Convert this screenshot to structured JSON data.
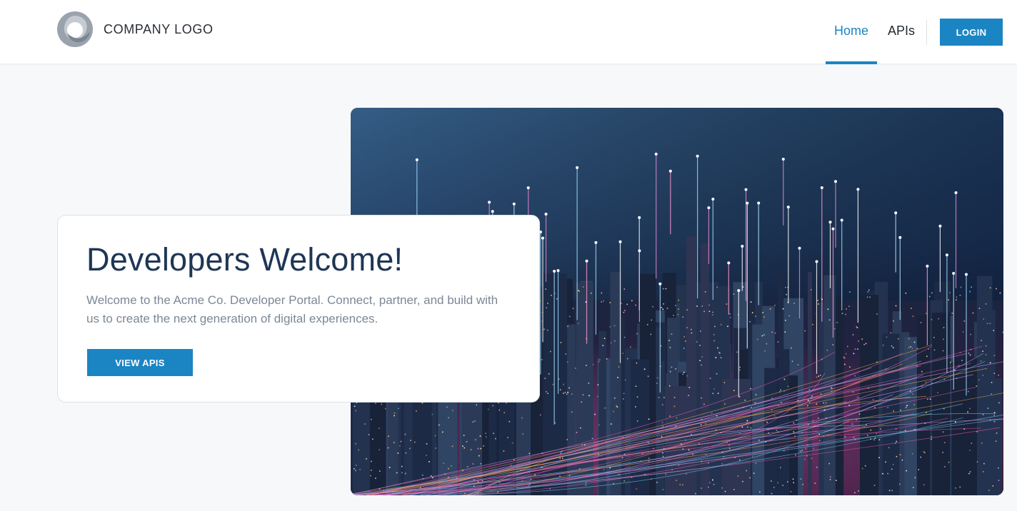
{
  "header": {
    "logo_text": "COMPANY LOGO",
    "nav": {
      "home": "Home",
      "apis": "APIs"
    },
    "login_label": "LOGIN"
  },
  "hero": {
    "title": "Developers Welcome!",
    "description": "Welcome to the Acme Co. Developer Portal. Connect, partner, and build with us to create the next generation of digital experiences.",
    "cta_label": "VIEW APIS",
    "image_alt": "City skyline at night"
  },
  "colors": {
    "accent": "#1b85c4",
    "title": "#1f3654",
    "muted_text": "#7b8896",
    "page_bg": "#f7f8fa"
  },
  "icons": {
    "logo": "company-logo-icon"
  }
}
